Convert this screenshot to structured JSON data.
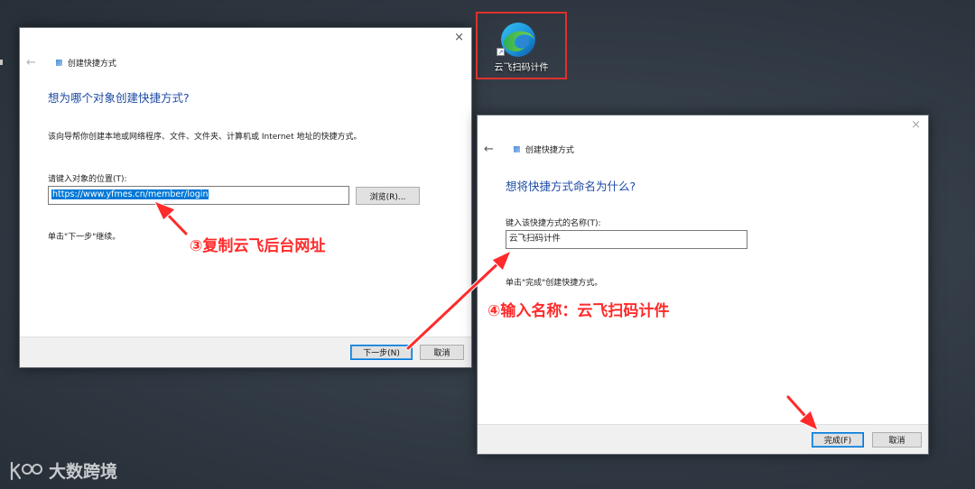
{
  "desktop": {
    "shortcut_label": "云飞扫码计件"
  },
  "wizard1": {
    "close_glyph": "×",
    "back_glyph": "←",
    "title": "创建快捷方式",
    "heading": "想为哪个对象创建快捷方式?",
    "description": "该向导帮你创建本地或网络程序、文件、文件夹、计算机或 Internet 地址的快捷方式。",
    "location_label": "请键入对象的位置(T):",
    "location_value": "https://www.yfmes.cn/member/login",
    "browse_label": "浏览(R)...",
    "hint": "单击\"下一步\"继续。",
    "next_label": "下一步(N)",
    "cancel_label": "取消"
  },
  "wizard2": {
    "close_glyph": "×",
    "back_glyph": "←",
    "title": "创建快捷方式",
    "heading": "想将快捷方式命名为什么?",
    "name_label": "键入该快捷方式的名称(T):",
    "name_value": "云飞扫码计件",
    "hint": "单击\"完成\"创建快捷方式。",
    "finish_label": "完成(F)",
    "cancel_label": "取消"
  },
  "annotations": {
    "step3": "③复制云飞后台网址",
    "step4": "④输入名称：云飞扫码计件",
    "color": "#ff2a2a"
  },
  "watermark": {
    "brand": "大数跨境",
    "logo_mark": "K"
  }
}
